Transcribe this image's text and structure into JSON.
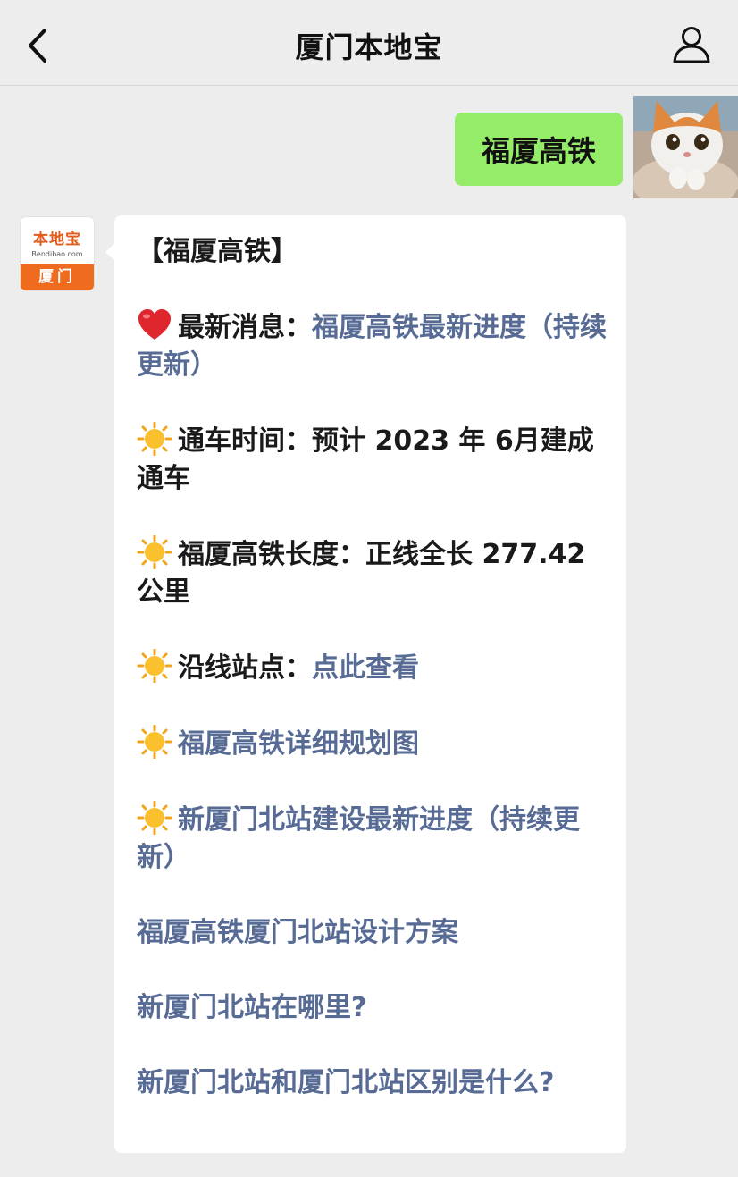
{
  "header": {
    "title": "厦门本地宝"
  },
  "outgoing": {
    "text": "福厦高铁"
  },
  "sender": {
    "logo_text": "本地宝",
    "logo_domain": "Bendibao.com",
    "logo_city": "厦门"
  },
  "reply": {
    "heading": "【福厦高铁】",
    "latest_label": "最新消息：",
    "latest_link": "福厦高铁最新进度（持续更新）",
    "open_label": "通车时间：",
    "open_value": "预计 2023 年 6月建成通车",
    "length_label": "福厦高铁长度：",
    "length_value": "正线全长 277.42 公里",
    "stations_label": "沿线站点：",
    "stations_link": "点此查看",
    "plan_link": "福厦高铁详细规划图",
    "north_progress_link": "新厦门北站建设最新进度（持续更新）",
    "design_link": "福厦高铁厦门北站设计方案",
    "where_link": "新厦门北站在哪里?",
    "diff_link": "新厦门北站和厦门北站区别是什么?"
  },
  "colors": {
    "link": "#576b95",
    "outgoing_bubble": "#95ec69",
    "background": "#ededed"
  },
  "icons": [
    "back-arrow-icon",
    "person-icon",
    "heart-icon",
    "sun-icon"
  ]
}
